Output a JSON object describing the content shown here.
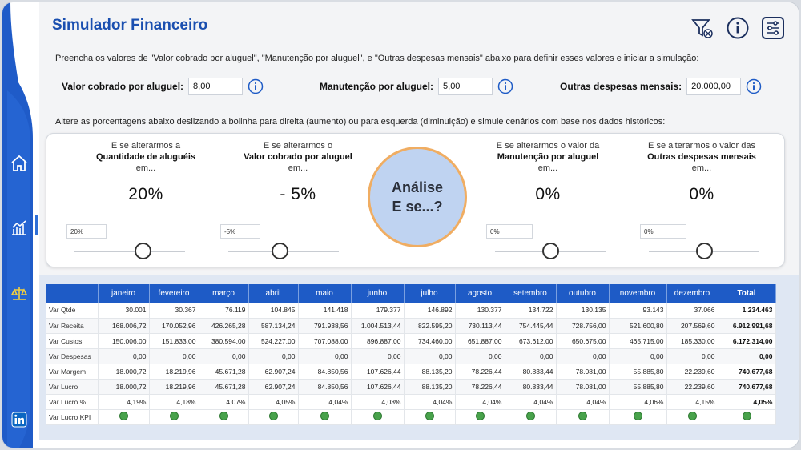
{
  "header": {
    "title": "Simulador Financeiro"
  },
  "top_icons": [
    "filter-clear-icon",
    "info-icon",
    "settings-sliders-icon"
  ],
  "instructions": {
    "line1": "Preencha os valores de \"Valor cobrado por aluguel\", \"Manutenção por aluguel\", e \"Outras despesas mensais\" abaixo para definir esses valores e iniciar a simulação:",
    "line2": "Altere as porcentagens abaixo deslizando a bolinha para direita (aumento) ou para esquerda (diminuição) e simule cenários com base nos dados históricos:"
  },
  "params": [
    {
      "label": "Valor cobrado por aluguel:",
      "value": "8,00"
    },
    {
      "label": "Manutenção por aluguel:",
      "value": "5,00"
    },
    {
      "label": "Outras despesas mensais:",
      "value": "20.000,00"
    }
  ],
  "simulators": [
    {
      "line1": "E se alterarmos a",
      "bold": "Quantidade de aluguéis",
      "line3": "em...",
      "pct": "20%",
      "input": "20%",
      "slider_fraction": 0.62
    },
    {
      "line1": "E se alterarmos o",
      "bold": "Valor cobrado por aluguel",
      "line3": "em...",
      "pct": "- 5%",
      "input": "-5%",
      "slider_fraction": 0.47
    },
    {
      "line1": "E se alterarmos o valor da",
      "bold": "Manutenção por aluguel",
      "line3": "em...",
      "pct": "0%",
      "input": "0%",
      "slider_fraction": 0.5
    },
    {
      "line1": "E se alterarmos o valor das",
      "bold": "Outras despesas mensais",
      "line3": "em...",
      "pct": "0%",
      "input": "0%",
      "slider_fraction": 0.5
    }
  ],
  "analysis": {
    "line1": "Análise",
    "line2": "E se...?"
  },
  "table": {
    "columns": [
      "janeiro",
      "fevereiro",
      "março",
      "abril",
      "maio",
      "junho",
      "julho",
      "agosto",
      "setembro",
      "outubro",
      "novembro",
      "dezembro",
      "Total"
    ],
    "rows": [
      {
        "label": "Var Qtde",
        "values": [
          "30.001",
          "30.367",
          "76.119",
          "104.845",
          "141.418",
          "179.377",
          "146.892",
          "130.377",
          "134.722",
          "130.135",
          "93.143",
          "37.066",
          "1.234.463"
        ]
      },
      {
        "label": "Var Receita",
        "values": [
          "168.006,72",
          "170.052,96",
          "426.265,28",
          "587.134,24",
          "791.938,56",
          "1.004.513,44",
          "822.595,20",
          "730.113,44",
          "754.445,44",
          "728.756,00",
          "521.600,80",
          "207.569,60",
          "6.912.991,68"
        ]
      },
      {
        "label": "Var Custos",
        "values": [
          "150.006,00",
          "151.833,00",
          "380.594,00",
          "524.227,00",
          "707.088,00",
          "896.887,00",
          "734.460,00",
          "651.887,00",
          "673.612,00",
          "650.675,00",
          "465.715,00",
          "185.330,00",
          "6.172.314,00"
        ]
      },
      {
        "label": "Var Despesas",
        "values": [
          "0,00",
          "0,00",
          "0,00",
          "0,00",
          "0,00",
          "0,00",
          "0,00",
          "0,00",
          "0,00",
          "0,00",
          "0,00",
          "0,00",
          "0,00"
        ]
      },
      {
        "label": "Var Margem",
        "values": [
          "18.000,72",
          "18.219,96",
          "45.671,28",
          "62.907,24",
          "84.850,56",
          "107.626,44",
          "88.135,20",
          "78.226,44",
          "80.833,44",
          "78.081,00",
          "55.885,80",
          "22.239,60",
          "740.677,68"
        ]
      },
      {
        "label": "Var Lucro",
        "values": [
          "18.000,72",
          "18.219,96",
          "45.671,28",
          "62.907,24",
          "84.850,56",
          "107.626,44",
          "88.135,20",
          "78.226,44",
          "80.833,44",
          "78.081,00",
          "55.885,80",
          "22.239,60",
          "740.677,68"
        ]
      },
      {
        "label": "Var Lucro %",
        "values": [
          "4,19%",
          "4,18%",
          "4,07%",
          "4,05%",
          "4,04%",
          "4,03%",
          "4,04%",
          "4,04%",
          "4,04%",
          "4,04%",
          "4,06%",
          "4,15%",
          "4,05%"
        ]
      }
    ],
    "kpi_label": "Var Lucro KPI",
    "kpi_color": "#48a24b"
  },
  "colors": {
    "accent": "#1e5bc6",
    "title": "#1a4fb0",
    "analysis_fill": "#bfd3f1",
    "analysis_border": "#f0ad62"
  },
  "sidebar": [
    "home-icon",
    "chart-icon",
    "scale-icon",
    "linkedin-icon"
  ]
}
